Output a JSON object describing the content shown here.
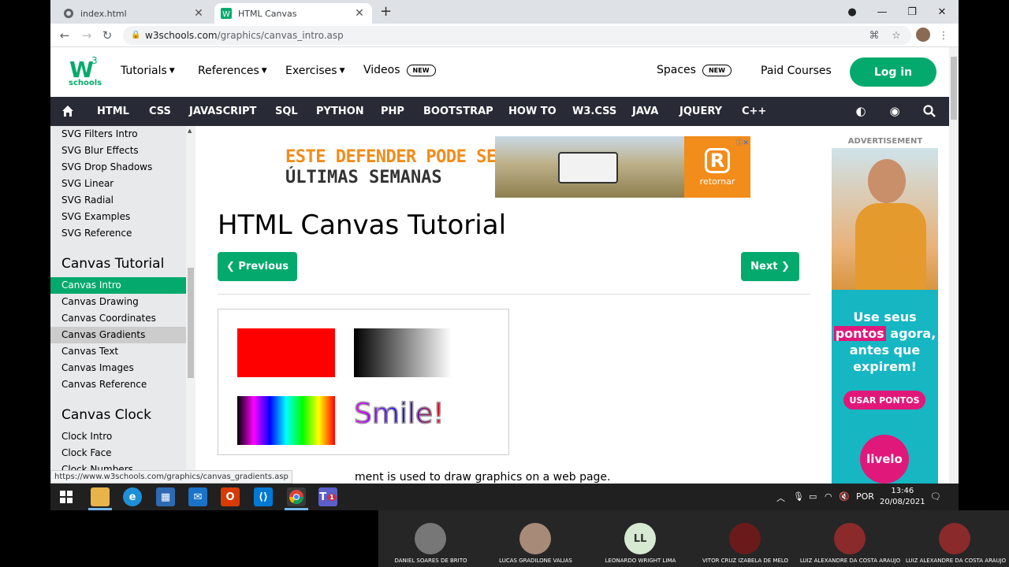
{
  "browser": {
    "tabs": [
      {
        "title": "index.html"
      },
      {
        "title": "HTML Canvas"
      }
    ],
    "url_host": "w3schools.com",
    "url_path": "/graphics/canvas_intro.asp"
  },
  "header": {
    "logo_top": "3",
    "logo_bottom": "schools",
    "nav": [
      "Tutorials",
      "References",
      "Exercises",
      "Videos"
    ],
    "videos_badge": "NEW",
    "spaces": "Spaces",
    "spaces_badge": "NEW",
    "paid_courses": "Paid Courses",
    "login": "Log in"
  },
  "darknav": [
    "HTML",
    "CSS",
    "JAVASCRIPT",
    "SQL",
    "PYTHON",
    "PHP",
    "BOOTSTRAP",
    "HOW TO",
    "W3.CSS",
    "JAVA",
    "JQUERY",
    "C++"
  ],
  "sidebar": {
    "svg_items": [
      "SVG Filters Intro",
      "SVG Blur Effects",
      "SVG Drop Shadows",
      "SVG Linear",
      "SVG Radial",
      "SVG Examples",
      "SVG Reference"
    ],
    "canvas_heading": "Canvas Tutorial",
    "canvas_items": [
      "Canvas Intro",
      "Canvas Drawing",
      "Canvas Coordinates",
      "Canvas Gradients",
      "Canvas Text",
      "Canvas Images",
      "Canvas Reference"
    ],
    "clock_heading": "Canvas Clock",
    "clock_items": [
      "Clock Intro",
      "Clock Face",
      "Clock Numbers"
    ]
  },
  "ad_top": {
    "line1": "ESTE DEFENDER PODE SER SEU",
    "line2": "ÚLTIMAS SEMANAS",
    "brand": "retornar"
  },
  "main": {
    "title": "HTML Canvas Tutorial",
    "prev": "❮ Previous",
    "next": "Next ❯",
    "smile": "Smile!",
    "body_fragment": "ment is used to draw graphics on a web page."
  },
  "ad_right": {
    "label": "ADVERTISEMENT",
    "line1": "Use seus",
    "highlight": "pontos",
    "line2": "agora,",
    "line3": "antes que",
    "line4": "expirem!",
    "cta": "USAR PONTOS",
    "brand": "livelo"
  },
  "status_url": "https://www.w3schools.com/graphics/canvas_gradients.asp",
  "taskbar": {
    "lang": "POR",
    "time": "13:46",
    "date": "20/08/2021",
    "teams_badge": "1"
  },
  "participants": [
    {
      "name": "DANIEL SOARES DE BRITO"
    },
    {
      "name": "LUCAS GRADILONE VALIAS"
    },
    {
      "name": "LEONARDO WRIGHT LIMA",
      "initials": "LL"
    },
    {
      "name": "VITOR CRUZ IZABELA DE MELO"
    },
    {
      "name": "LUIZ ALEXANDRE DA COSTA ARAUJO"
    },
    {
      "name": "LUIZ ALEXANDRE DA COSTA ARAUJO"
    }
  ]
}
